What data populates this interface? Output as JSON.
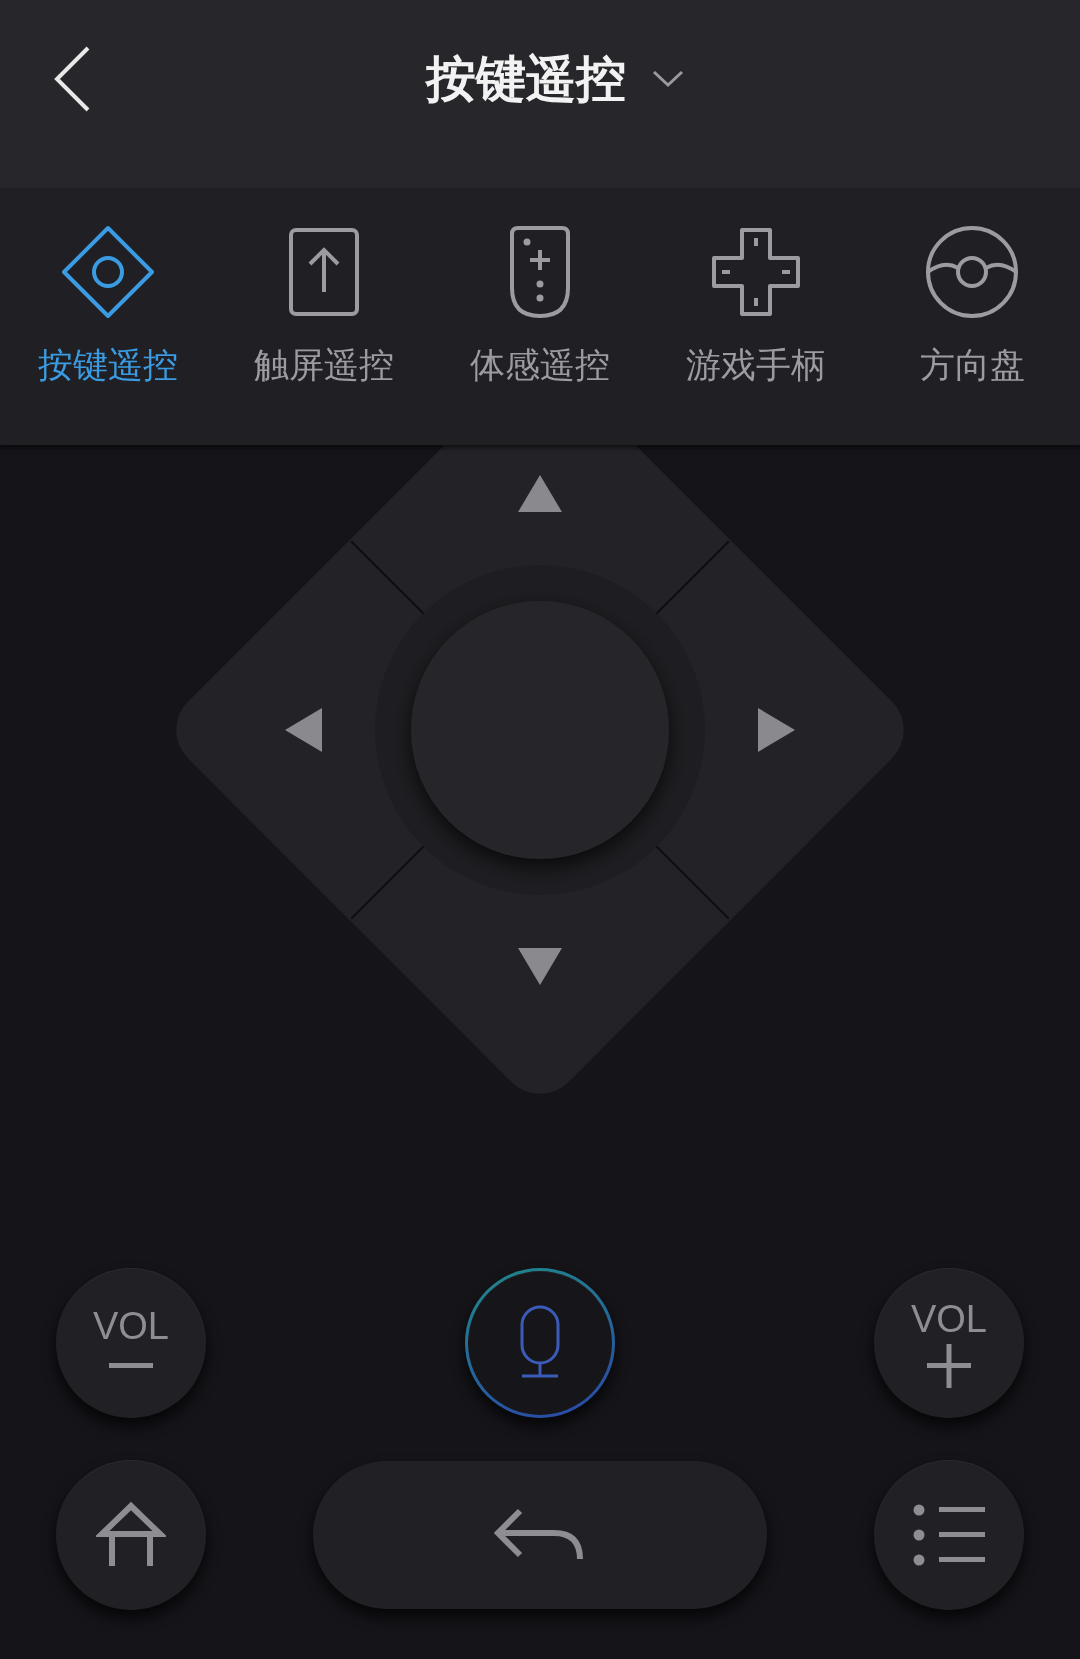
{
  "header": {
    "title": "按键遥控"
  },
  "tabs": [
    {
      "label": "按键遥控",
      "kind": "keys",
      "selected": true
    },
    {
      "label": "触屏遥控",
      "kind": "touch",
      "selected": false
    },
    {
      "label": "体感遥控",
      "kind": "motion",
      "selected": false
    },
    {
      "label": "游戏手柄",
      "kind": "gamepad",
      "selected": false
    },
    {
      "label": "方向盘",
      "kind": "wheel",
      "selected": false
    }
  ],
  "volume_down": {
    "label": "VOL"
  },
  "volume_up": {
    "label": "VOL"
  }
}
